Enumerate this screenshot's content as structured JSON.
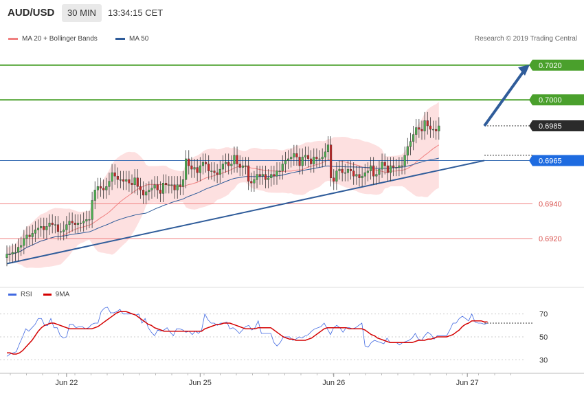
{
  "header": {
    "symbol": "AUD/USD",
    "timeframe": "30 MIN",
    "time": "13:34:15 CET"
  },
  "legend": {
    "ma20": "MA 20 + Bollinger Bands",
    "ma50": "MA 50",
    "copyright": "Research © 2019 Trading Central"
  },
  "rsi_legend": {
    "rsi": "RSI",
    "ma": "9MA"
  },
  "colors": {
    "up": "#4caf50",
    "down": "#c62828",
    "ma20": "#f08080",
    "ma50": "#2f5c9a",
    "band": "#fde0e0",
    "target": "#4aa02c",
    "support": "#f08080",
    "pivot_line": "#3b6fb5",
    "arrow": "#2f5c9a",
    "rsi": "#4169e1",
    "rsi_ma": "#d40000"
  },
  "chart_data": [
    {
      "type": "candlestick",
      "title": "AUD/USD 30 MIN",
      "ylim": [
        0.6895,
        0.7033
      ],
      "x": [
        "Jun 22",
        "Jun 25",
        "Jun 26",
        "Jun 27"
      ],
      "x_tick_positions": [
        21,
        68,
        115,
        162
      ],
      "x_range": [
        0,
        168
      ],
      "levels": [
        {
          "value": 0.702,
          "label": "0.7020",
          "kind": "resistance"
        },
        {
          "value": 0.7,
          "label": "0.7000",
          "kind": "resistance"
        },
        {
          "value": 0.6985,
          "label": "0.6985",
          "kind": "last"
        },
        {
          "value": 0.6965,
          "label": "0.6965",
          "kind": "pivot"
        },
        {
          "value": 0.694,
          "label": "0.6940",
          "kind": "support"
        },
        {
          "value": 0.692,
          "label": "0.6920",
          "kind": "support"
        }
      ],
      "close": [
        0.6911,
        0.6911,
        0.6912,
        0.6912,
        0.6915,
        0.6916,
        0.692,
        0.6922,
        0.6921,
        0.6923,
        0.6925,
        0.6926,
        0.6927,
        0.6925,
        0.6927,
        0.6929,
        0.6928,
        0.6928,
        0.6924,
        0.6924,
        0.6925,
        0.6928,
        0.693,
        0.6929,
        0.6928,
        0.6929,
        0.6929,
        0.693,
        0.6931,
        0.6931,
        0.6942,
        0.6948,
        0.695,
        0.6949,
        0.6948,
        0.695,
        0.6953,
        0.6958,
        0.6956,
        0.6954,
        0.6954,
        0.6953,
        0.6954,
        0.6952,
        0.6951,
        0.6955,
        0.695,
        0.6948,
        0.6945,
        0.6947,
        0.6948,
        0.6949,
        0.6951,
        0.6948,
        0.6946,
        0.6952,
        0.6951,
        0.6951,
        0.6951,
        0.6948,
        0.6951,
        0.695,
        0.6954,
        0.6966,
        0.6962,
        0.696,
        0.6961,
        0.6958,
        0.6962,
        0.6964,
        0.6963,
        0.6959,
        0.6959,
        0.6958,
        0.6957,
        0.696,
        0.6963,
        0.6964,
        0.6962,
        0.6963,
        0.6968,
        0.6963,
        0.6961,
        0.6962,
        0.6962,
        0.6953,
        0.6952,
        0.6954,
        0.6957,
        0.6956,
        0.6957,
        0.6954,
        0.6955,
        0.6957,
        0.6956,
        0.6959,
        0.6959,
        0.6963,
        0.6965,
        0.6966,
        0.6967,
        0.6969,
        0.6967,
        0.6962,
        0.6967,
        0.6968,
        0.6966,
        0.6963,
        0.6967,
        0.6966,
        0.6966,
        0.6967,
        0.697,
        0.6974,
        0.6955,
        0.6953,
        0.6959,
        0.696,
        0.6958,
        0.6958,
        0.696,
        0.6959,
        0.6956,
        0.6957,
        0.6955,
        0.6956,
        0.6958,
        0.6959,
        0.6962,
        0.6956,
        0.6957,
        0.696,
        0.6964,
        0.6962,
        0.6958,
        0.6962,
        0.6961,
        0.6961,
        0.6962,
        0.6962,
        0.6968,
        0.6973,
        0.6976,
        0.698,
        0.6984,
        0.6983,
        0.6982,
        0.6988,
        0.6985,
        0.6983,
        0.6983,
        0.6982,
        0.6985
      ]
    },
    {
      "type": "line",
      "title": "RSI",
      "ylim": [
        20,
        80
      ],
      "y_ticks": [
        30,
        50,
        70
      ],
      "series": [
        {
          "name": "RSI",
          "values": [
            33,
            35,
            36,
            37,
            44,
            50,
            57,
            55,
            58,
            61,
            66,
            66,
            60,
            60,
            66,
            58,
            58,
            51,
            49,
            50,
            61,
            61,
            58,
            59,
            59,
            57,
            58,
            61,
            62,
            62,
            72,
            75,
            76,
            71,
            71,
            72,
            74,
            70,
            70,
            70,
            70,
            69,
            70,
            62,
            66,
            58,
            54,
            51,
            56,
            55,
            56,
            58,
            54,
            51,
            57,
            57,
            56,
            54,
            55,
            52,
            55,
            53,
            56,
            70,
            65,
            62,
            62,
            60,
            62,
            62,
            63,
            57,
            58,
            56,
            53,
            56,
            59,
            60,
            56,
            58,
            64,
            53,
            53,
            53,
            53,
            45,
            42,
            45,
            50,
            50,
            50,
            47,
            48,
            50,
            49,
            51,
            52,
            55,
            57,
            58,
            59,
            62,
            57,
            52,
            58,
            60,
            58,
            54,
            58,
            58,
            57,
            58,
            60,
            62,
            42,
            41,
            45,
            47,
            46,
            45,
            44,
            49,
            45,
            45,
            45,
            43,
            45,
            46,
            47,
            49,
            53,
            48,
            47,
            51,
            54,
            52,
            48,
            51,
            51,
            51,
            51,
            56,
            62,
            62,
            66,
            68,
            66,
            64,
            70,
            63,
            62,
            62,
            61,
            62
          ]
        },
        {
          "name": "9MA",
          "values": [
            36,
            36,
            35,
            35,
            36,
            38,
            41,
            44,
            47,
            51,
            55,
            58,
            60,
            61,
            62,
            62,
            61,
            60,
            59,
            58,
            57,
            57,
            57,
            57,
            57,
            57,
            57,
            57,
            58,
            59,
            61,
            63,
            65,
            67,
            69,
            71,
            72,
            72,
            72,
            71,
            70,
            69,
            67,
            65,
            63,
            61,
            60,
            58,
            57,
            56,
            55,
            55,
            55,
            55,
            55,
            55,
            55,
            55,
            55,
            55,
            55,
            55,
            55,
            57,
            58,
            59,
            60,
            61,
            61,
            62,
            62,
            62,
            61,
            60,
            59,
            58,
            57,
            57,
            57,
            57,
            58,
            58,
            58,
            58,
            58,
            56,
            54,
            52,
            50,
            49,
            48,
            48,
            47,
            47,
            47,
            47,
            48,
            49,
            51,
            53,
            55,
            57,
            58,
            58,
            58,
            58,
            58,
            58,
            58,
            57,
            57,
            57,
            57,
            57,
            56,
            54,
            52,
            51,
            49,
            48,
            47,
            46,
            45,
            45,
            45,
            45,
            45,
            45,
            45,
            45,
            46,
            47,
            47,
            47,
            48,
            48,
            49,
            50,
            50,
            50,
            50,
            51,
            52,
            54,
            56,
            59,
            61,
            62,
            64,
            64,
            64,
            64,
            63,
            63
          ]
        }
      ]
    }
  ]
}
